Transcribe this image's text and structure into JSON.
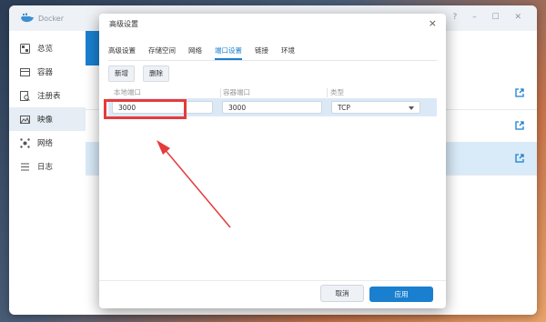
{
  "app": {
    "title": "Docker",
    "controls": "? – ☐ ✕"
  },
  "sidebar": {
    "items": [
      {
        "label": "总览",
        "icon": "overview-icon"
      },
      {
        "label": "容器",
        "icon": "container-icon"
      },
      {
        "label": "注册表",
        "icon": "registry-icon"
      },
      {
        "label": "映像",
        "icon": "image-icon",
        "active": true
      },
      {
        "label": "网络",
        "icon": "network-icon"
      },
      {
        "label": "日志",
        "icon": "log-icon"
      }
    ]
  },
  "dialog": {
    "title": "高级设置",
    "close": "×",
    "tabs": [
      "高级设置",
      "存储空间",
      "网络",
      "端口设置",
      "链接",
      "环境"
    ],
    "active_tab": "端口设置",
    "add_label": "新增",
    "delete_label": "删除",
    "columns": {
      "local_port": "本地端口",
      "container_port": "容器端口",
      "type": "类型"
    },
    "row": {
      "local_port": "3000",
      "container_port": "3000",
      "type": "TCP"
    },
    "cancel_label": "取消",
    "apply_label": "应用"
  },
  "colors": {
    "accent": "#1a7fcf",
    "annotation": "#e53b3b"
  }
}
